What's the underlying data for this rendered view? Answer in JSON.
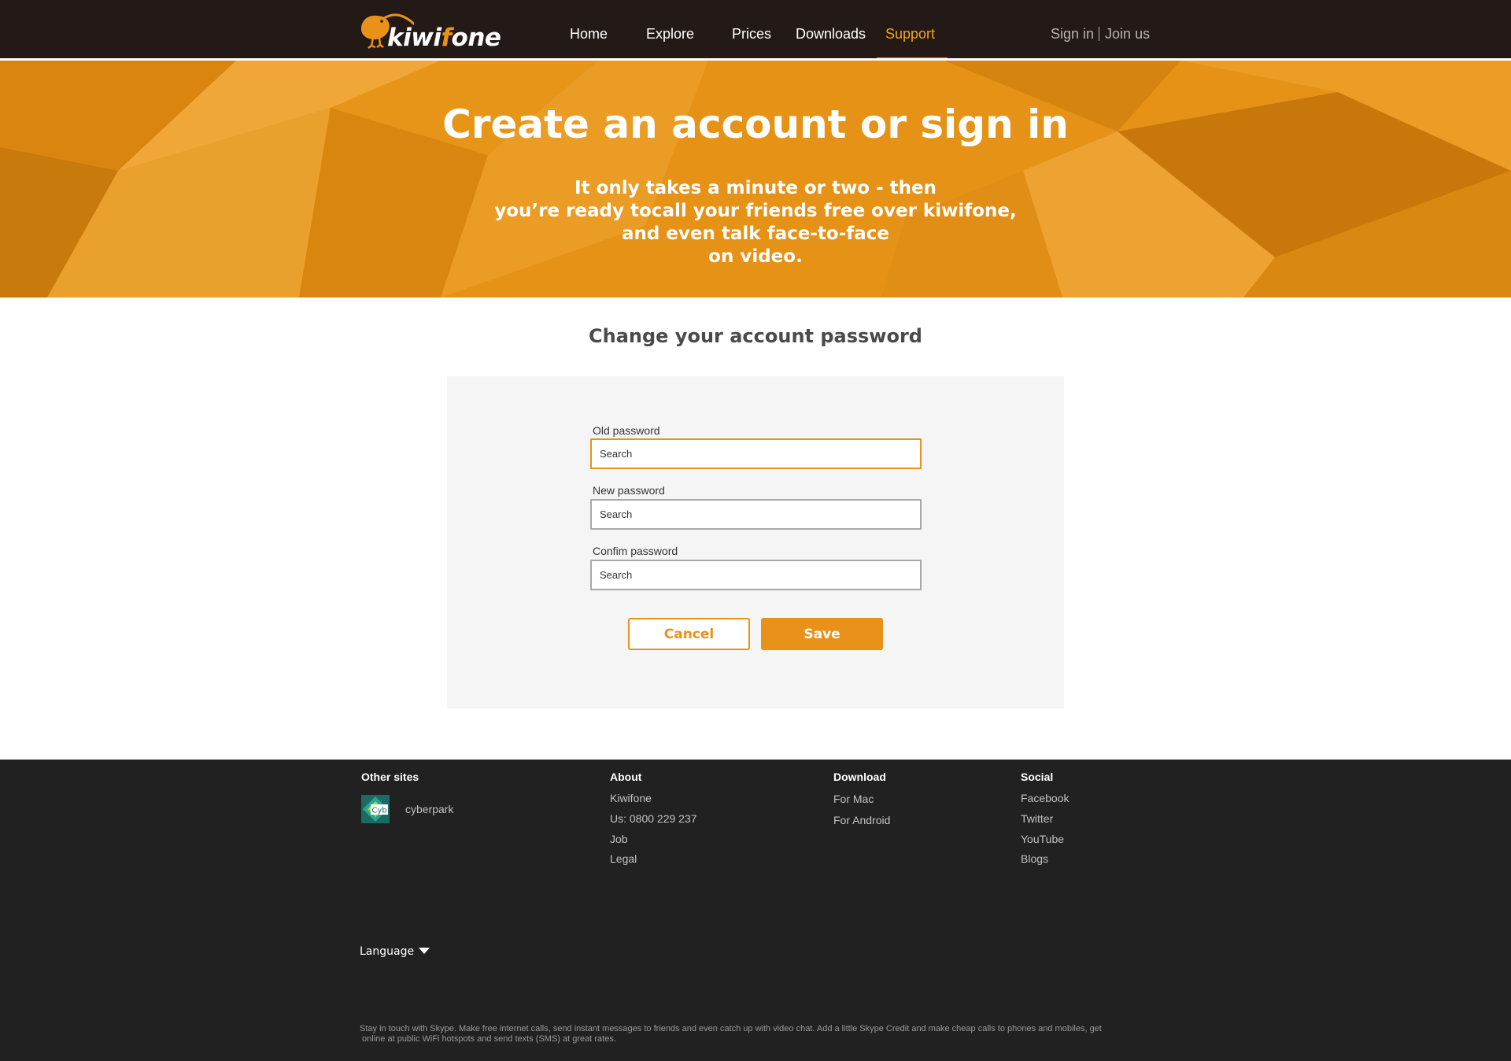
{
  "brand": {
    "name_part1": "kiwi",
    "name_accent": "f",
    "name_part2": "one",
    "accent_color": "#e8921a"
  },
  "nav": {
    "items": [
      {
        "label": "Home",
        "active": false
      },
      {
        "label": "Explore",
        "active": false
      },
      {
        "label": "Prices",
        "active": false
      },
      {
        "label": "Downloads",
        "active": false
      },
      {
        "label": "Support",
        "active": true
      }
    ],
    "sign_in": "Sign in",
    "join_us": "Join us"
  },
  "hero": {
    "title": "Create an account or sign in",
    "subtitle_lines": [
      "It only takes a minute or two - then",
      "you’re ready tocall your friends free over kiwifone,",
      "and even talk face-to-face",
      "on video."
    ]
  },
  "form": {
    "title": "Change your account password",
    "fields": [
      {
        "label": "Old password",
        "placeholder": "Search"
      },
      {
        "label": "New password",
        "placeholder": "Search"
      },
      {
        "label": "Confim password",
        "placeholder": "Search"
      }
    ],
    "cancel_label": "Cancel",
    "save_label": "Save"
  },
  "footer": {
    "other_sites": {
      "title": "Other sites",
      "logo_text": "Cyb",
      "items": [
        "cyberpark"
      ]
    },
    "about": {
      "title": "About",
      "items": [
        "Kiwifone",
        "Us: 0800 229 237",
        "Job",
        "Legal"
      ]
    },
    "download": {
      "title": "Download",
      "items": [
        "For Mac",
        "For Android"
      ]
    },
    "social": {
      "title": "Social",
      "items": [
        "Facebook",
        "Twitter",
        "YouTube",
        "Blogs"
      ]
    },
    "language_label": "Language",
    "disclaimer_lines": [
      "Stay in touch with Skype. Make free internet calls, send instant messages to friends and even catch up with video chat. Add a little Skype Credit and make cheap calls to phones and mobiles, get",
      " online at public WiFi hotspots and send texts (SMS) at great rates."
    ]
  }
}
